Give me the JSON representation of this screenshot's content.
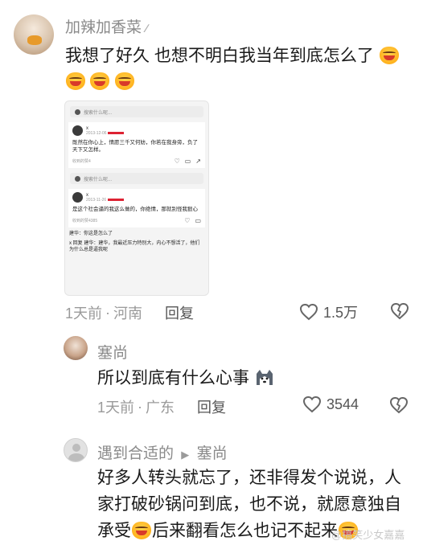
{
  "comment1": {
    "username": "加辣加香菜",
    "text": "我想了好久 也想不明白我当年到底怎么了",
    "time": "1天前",
    "location": "河南",
    "reply_label": "回复",
    "like_count": "1.5万",
    "embedded": {
      "search_placeholder": "搜索什么呢...",
      "post1": {
        "user": "x",
        "date": "2013-12-06",
        "text": "既然在你心上，情愿三千又何妨，你若在我身旁，负了天下又怎样。",
        "source": "收到的赞4"
      },
      "search_placeholder2": "搜索什么呢...",
      "post2": {
        "user": "x",
        "date": "2013-11-26",
        "text": "是这个社会逼的我这么做的，你绝情，那就别怪我狠心",
        "source": "收到的赞4385"
      },
      "bottom_text1": "建华：你这是怎么了",
      "bottom_text2": "x 回复 建华：建华，我最近压力特别大，内心不想活了，他们为什么总是逼我呢"
    }
  },
  "comment2": {
    "username": "塞尚",
    "text": "所以到底有什么心事",
    "time": "1天前",
    "location": "广东",
    "reply_label": "回复",
    "like_count": "3544"
  },
  "comment3": {
    "username": "遇到合适的",
    "reply_arrow": "▶",
    "reply_to": "塞尚",
    "text_line1": "好多人转头就忘了，还非得发个说说，人",
    "text_line2": "家打破砂锅问到底，也不说，就愿意独自",
    "text_line3a": "承受",
    "text_line3b": "后来翻看怎么也记不起来"
  },
  "watermark": "@搞笑少女嘉嘉",
  "separator": "·"
}
